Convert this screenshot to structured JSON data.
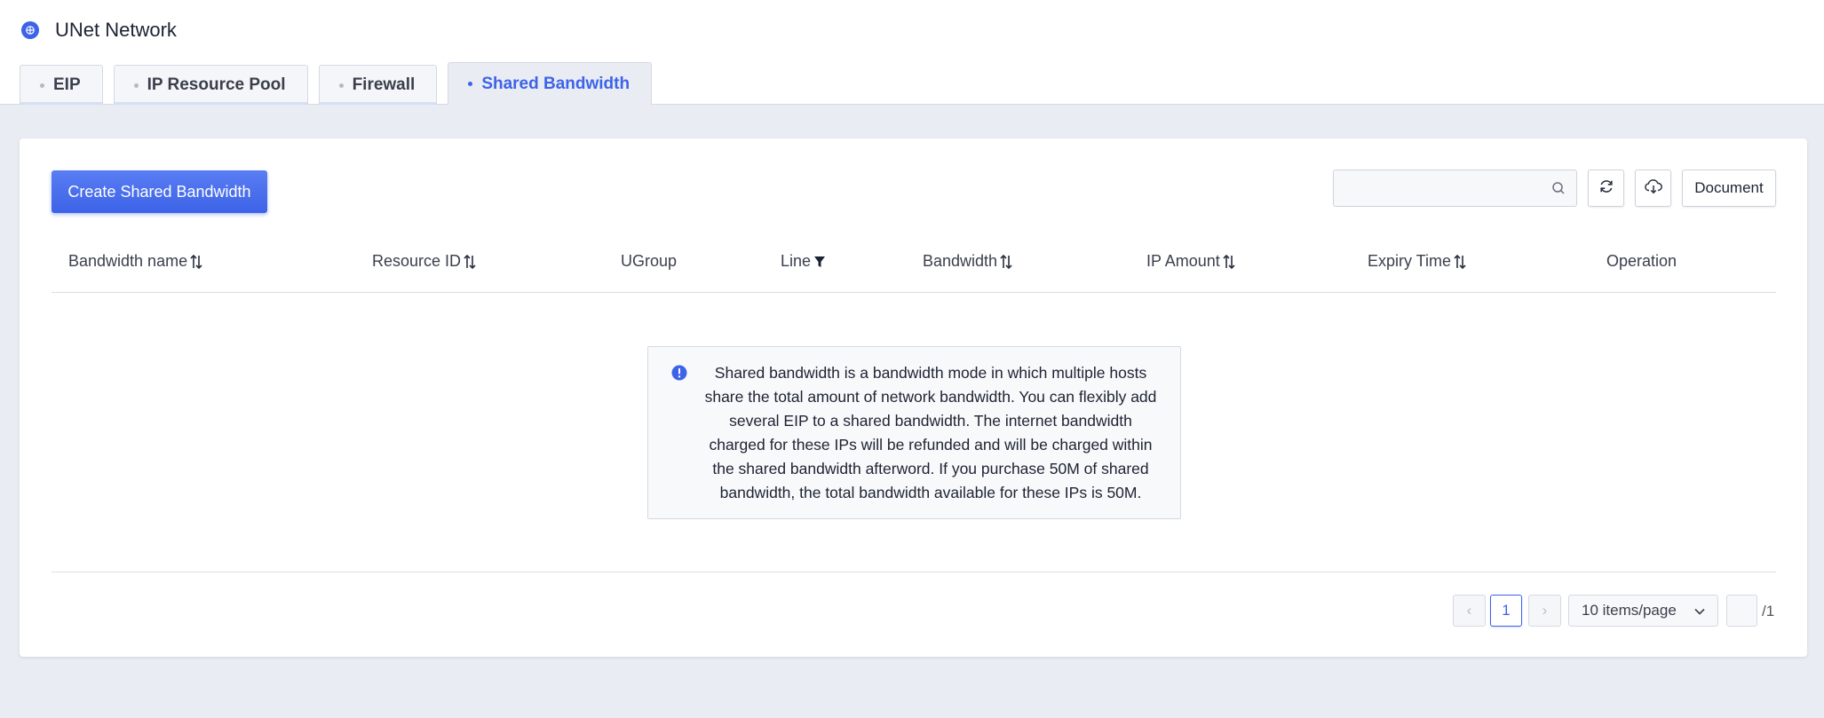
{
  "app": {
    "title": "UNet Network"
  },
  "tabs": [
    {
      "label": "EIP",
      "active": false
    },
    {
      "label": "IP Resource Pool",
      "active": false
    },
    {
      "label": "Firewall",
      "active": false
    },
    {
      "label": "Shared Bandwidth",
      "active": true
    }
  ],
  "toolbar": {
    "create_label": "Create Shared Bandwidth",
    "search_placeholder": "",
    "document_label": "Document"
  },
  "table": {
    "columns": [
      {
        "label": "Bandwidth name",
        "icon": "sort-icon"
      },
      {
        "label": "Resource ID",
        "icon": "sort-icon"
      },
      {
        "label": "UGroup",
        "icon": ""
      },
      {
        "label": "Line",
        "icon": "filter-icon"
      },
      {
        "label": "Bandwidth",
        "icon": "sort-icon"
      },
      {
        "label": "IP Amount",
        "icon": "sort-icon"
      },
      {
        "label": "Expiry Time",
        "icon": "sort-icon"
      },
      {
        "label": "Operation",
        "icon": ""
      }
    ],
    "rows": []
  },
  "empty_state": {
    "message": "Shared bandwidth is a bandwidth mode in which multiple hosts share the total amount of network bandwidth. You can flexibly add several EIP to a shared bandwidth. The internet bandwidth charged for these IPs will be refunded and will be charged within the shared bandwidth afterword. If you purchase 50M of shared bandwidth, the total bandwidth available for these IPs is 50M."
  },
  "pagination": {
    "prev": "‹",
    "current_page": "1",
    "next": "›",
    "page_size": "10 items/page",
    "jump_value": "",
    "total_pages": "/1"
  },
  "colors": {
    "accent": "#3d63e8",
    "page_bg": "#e9ecf3"
  }
}
